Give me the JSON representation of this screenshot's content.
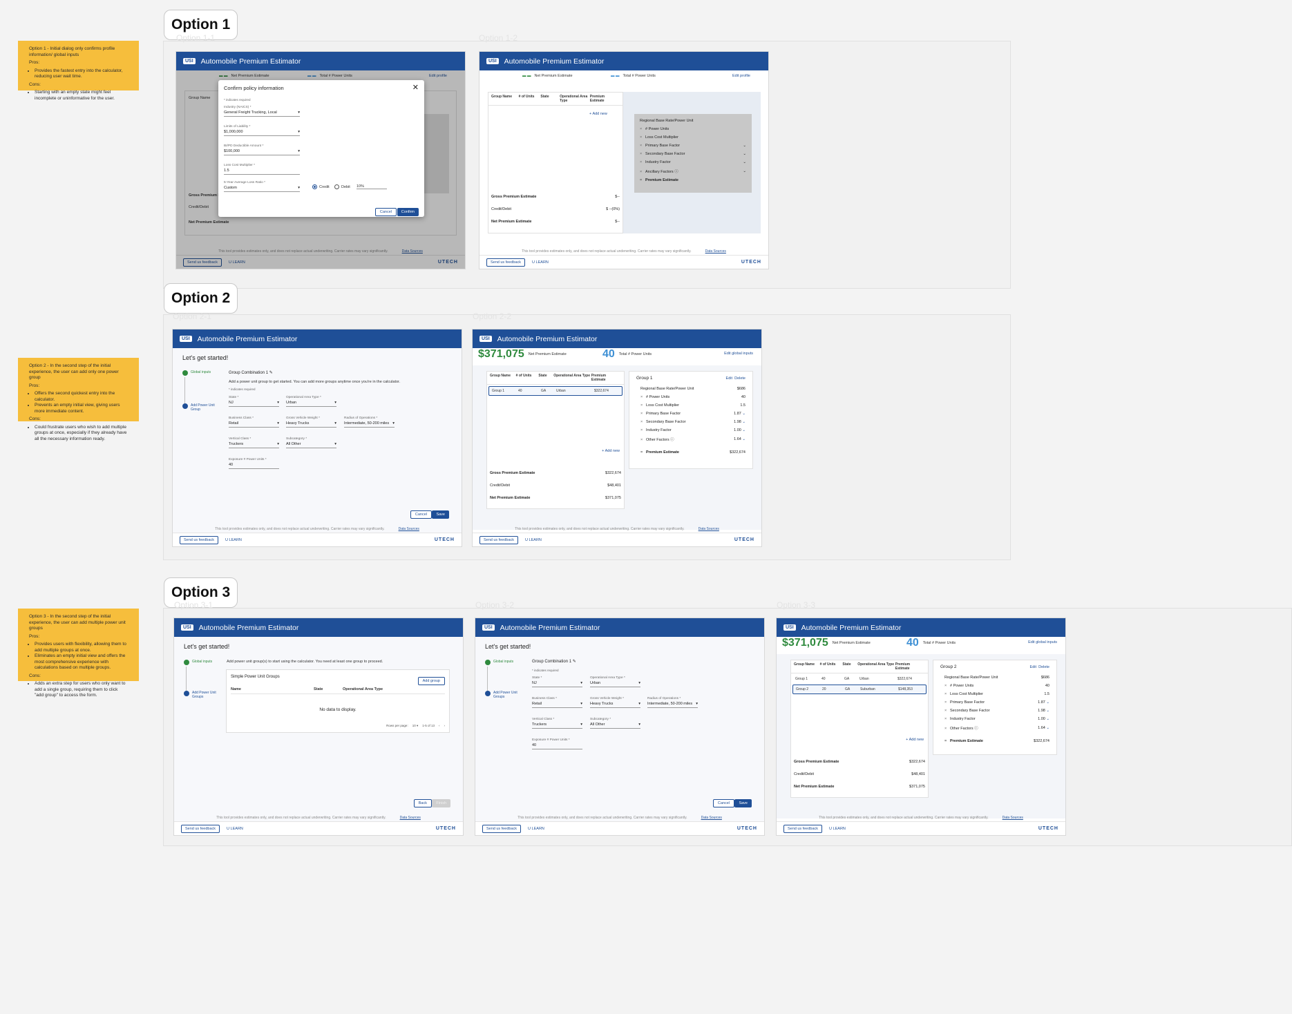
{
  "options": [
    {
      "label": "Option 1",
      "note_intro": "Option 1 - Initial dialog only confirms profile information/ global inputs",
      "pros_label": "Pros:",
      "pros": [
        "Provides the fastest entry into the calculator, reducing user wait time."
      ],
      "cons_label": "Cons:",
      "cons": [
        "Starting with an empty state might feel incomplete or uninformative for the user."
      ]
    },
    {
      "label": "Option 2",
      "note_intro": "Option 2 - In the second step of the initial experience, the user can add only one power group",
      "pros_label": "Pros:",
      "pros": [
        "Offers the second quickest entry into the calculator.",
        "Prevents an empty initial view, giving users more immediate content."
      ],
      "cons_label": "Cons:",
      "cons": [
        "Could frustrate users who wish to add multiple groups at once, especially if they already have all the necessary information ready."
      ]
    },
    {
      "label": "Option 3",
      "note_intro": "Option 3 - In the second step of the initial experience, the user can add multiple power unit groups",
      "pros_label": "Pros:",
      "pros": [
        "Provides users with flexibility, allowing them to add multiple groups at once.",
        "Eliminates an empty initial view and offers the most comprehensive experience with calculations based on multiple groups."
      ],
      "cons_label": "Cons:",
      "cons": [
        "Adds an extra step for users who only want to add a single group, requiring them to click \"add group\" to access the form."
      ]
    }
  ],
  "frame_labels": {
    "f11": "Option 1-1",
    "f12": "Option 1-2",
    "f21": "Option 2-1",
    "f22": "Option 2-2",
    "f31": "Option 3-1",
    "f32": "Option 3-2",
    "f33": "Option 3-3"
  },
  "app": {
    "title": "Automobile Premium Estimator",
    "logo": "USI",
    "net_premium_label": "Net Premium Estimate",
    "total_units_label": "Total # Power Units",
    "edit_profile": "Edit profile",
    "edit_global": "Edit global inputs",
    "disclaimer": "This tool provides estimates only, and does not replace actual underwriting. Carrier rates may vary significantly.",
    "data_sources": "Data Sources",
    "feedback": "Send us feedback",
    "ulearn": "U LEARN",
    "utech": "UTECH",
    "get_started": "Let's get started!",
    "step_global": "Global inputs",
    "step_add": "Add Power Unit Group",
    "step_add_plural": "Add Power Unit Groups",
    "add_new": "Add new",
    "cancel": "Cancel",
    "save": "Save",
    "confirm": "Confirm",
    "back": "Back",
    "finish": "Finish"
  },
  "table_headers": [
    "Group Name",
    "# of Units",
    "State",
    "Operational Area Type",
    "Premium Estimate"
  ],
  "summary": {
    "gross": "Gross Premium Estimate",
    "credit": "Credit/Debit",
    "net": "Net Premium Estimate"
  },
  "dialog": {
    "title": "Confirm policy information",
    "required": "* indicates required",
    "fields": [
      {
        "label": "Industry (NAICS) *",
        "value": "General Freight Trucking, Local"
      },
      {
        "label": "Limits of Liability *",
        "value": "$1,000,000"
      },
      {
        "label": "BI/PD Deductible Amount *",
        "value": "$100,000"
      },
      {
        "label": "Loss Cost Multiplier *",
        "value": "1.5"
      },
      {
        "label": "5-Year Average Loss Ratio *",
        "value": "Custom"
      }
    ],
    "credit": "Credit",
    "debit": "Debit",
    "pct": "10%"
  },
  "empty_factors": [
    "Regional Base Rate/Power Unit",
    "# Power Units",
    "Loss Cost Multiplier",
    "Primary Base Factor",
    "Secondary Base Factor",
    "Industry Factor",
    "Ancillary Factors",
    "Premium Estimate"
  ],
  "empty_values": {
    "gross": "$--",
    "credit": "$ --(0%)",
    "net": "$--"
  },
  "group_form": {
    "title": "Group Combination 1",
    "intro": "Add a power unit group to get started. You can add more groups anytime once you're in the calculator.",
    "required": "* indicates required",
    "state": {
      "label": "State *",
      "value": "NJ"
    },
    "area": {
      "label": "Operational Area Type *",
      "value": "Urban"
    },
    "business": {
      "label": "Business Class *",
      "value": "Retail"
    },
    "gvw": {
      "label": "Gross Vehicle Weight *",
      "value": "Heavy Trucks"
    },
    "radius": {
      "label": "Radius of Operations *",
      "value": "Intermediate, 50-200 miles"
    },
    "vertical": {
      "label": "Vertical Class *",
      "value": "Truckers"
    },
    "sub": {
      "label": "Subcategory *",
      "value": "All Other"
    },
    "exposure": {
      "label": "Exposure # Power Units *",
      "value": "40"
    }
  },
  "filled": {
    "net": "$371,075",
    "units": "40",
    "units2": "40",
    "rows_o2": [
      [
        "Group 1",
        "40",
        "GA",
        "Urban",
        "$322,674"
      ]
    ],
    "rows_o3": [
      [
        "Group 1",
        "40",
        "GA",
        "Urban",
        "$322,674"
      ],
      [
        "Group 2",
        "20",
        "GA",
        "Suburban",
        "$148,353"
      ]
    ],
    "gross": "$322,674",
    "credit": "$48,401",
    "netv": "$371,075",
    "group1": "Group 1",
    "group2": "Group 2",
    "edit": "Edit",
    "delete": "Delete",
    "factors": [
      [
        "Regional Base Rate/Power Unit",
        "$686"
      ],
      [
        "# Power Units",
        "40"
      ],
      [
        "Loss Cost Multiplier",
        "1.5"
      ],
      [
        "Primary Base Factor",
        "1.87"
      ],
      [
        "Secondary Base Factor",
        "1.98"
      ],
      [
        "Industry Factor",
        "1.00"
      ],
      [
        "Other Factors",
        "1.64"
      ]
    ],
    "premium_label": "Premium Estimate",
    "premium_value": "$322,674"
  },
  "o3_list": {
    "intro": "Add power unit group(s) to start using the calculator. You need at least one group to proceed.",
    "title": "Simple Power Unit Groups",
    "add_group": "Add group",
    "cols": [
      "Name",
      "State",
      "Operational Area Type"
    ],
    "empty": "No data to display.",
    "rows_per_page": "Rows per page:",
    "rpp_value": "10",
    "range": "1-5 of 13"
  }
}
